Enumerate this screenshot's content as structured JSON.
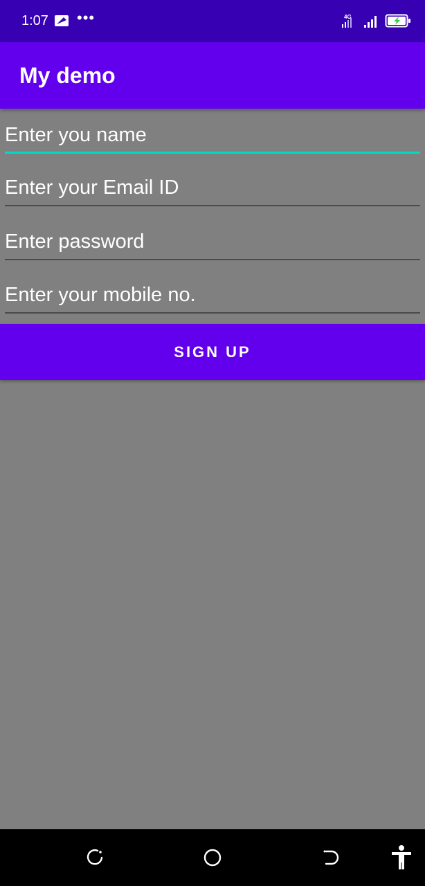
{
  "status_bar": {
    "time": "1:07",
    "dots": "•••",
    "network_label": "4G",
    "icons": [
      "message-icon",
      "more-notifications-icon",
      "signal-4g-icon",
      "signal-bars-icon",
      "battery-charging-icon"
    ]
  },
  "app_bar": {
    "title": "My demo",
    "color": "#6200ee"
  },
  "form": {
    "name_placeholder": "Enter you name",
    "email_placeholder": "Enter your Email ID",
    "password_placeholder": "Enter password",
    "mobile_placeholder": "Enter your mobile no.",
    "signup_label": "SIGN UP",
    "accent_color": "#03dac5",
    "focused_field": "name"
  },
  "nav_bar": {
    "icons": [
      "recents-icon",
      "home-icon",
      "back-icon",
      "accessibility-icon"
    ]
  }
}
